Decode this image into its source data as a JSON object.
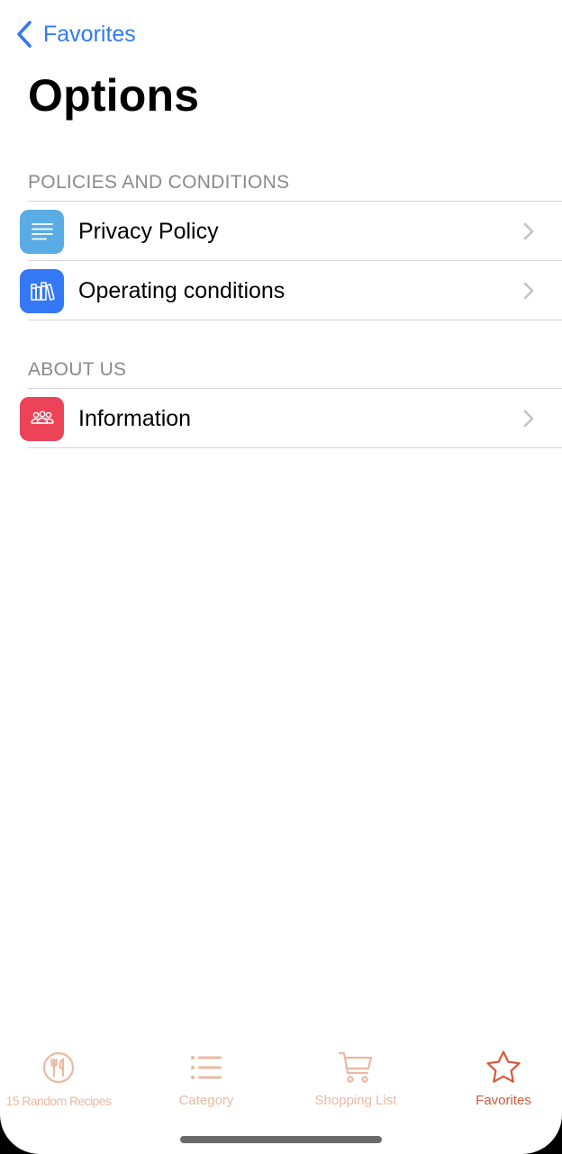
{
  "nav": {
    "back_label": "Favorites",
    "title": "Options"
  },
  "sections": [
    {
      "header": "POLICIES AND CONDITIONS",
      "items": [
        {
          "label": "Privacy Policy",
          "icon": "document-lines-icon",
          "icon_color": "#5aace5"
        },
        {
          "label": "Operating conditions",
          "icon": "books-icon",
          "icon_color": "#3478f6"
        }
      ]
    },
    {
      "header": "ABOUT US",
      "items": [
        {
          "label": "Information",
          "icon": "group-people-icon",
          "icon_color": "#ec4359"
        }
      ]
    }
  ],
  "tabbar": {
    "active_tab": "Favorites",
    "inactive_color": "#ebb8a2",
    "active_color": "#d4593e",
    "tabs": [
      {
        "label": "15 Random Recipes",
        "icon": "plate-cutlery-icon"
      },
      {
        "label": "Category",
        "icon": "list-icon"
      },
      {
        "label": "Shopping List",
        "icon": "cart-icon"
      },
      {
        "label": "Favorites",
        "icon": "star-icon"
      }
    ]
  },
  "colors": {
    "accent": "#3478f6",
    "section_header": "#8a8a8e",
    "divider": "#d6d6d8"
  }
}
